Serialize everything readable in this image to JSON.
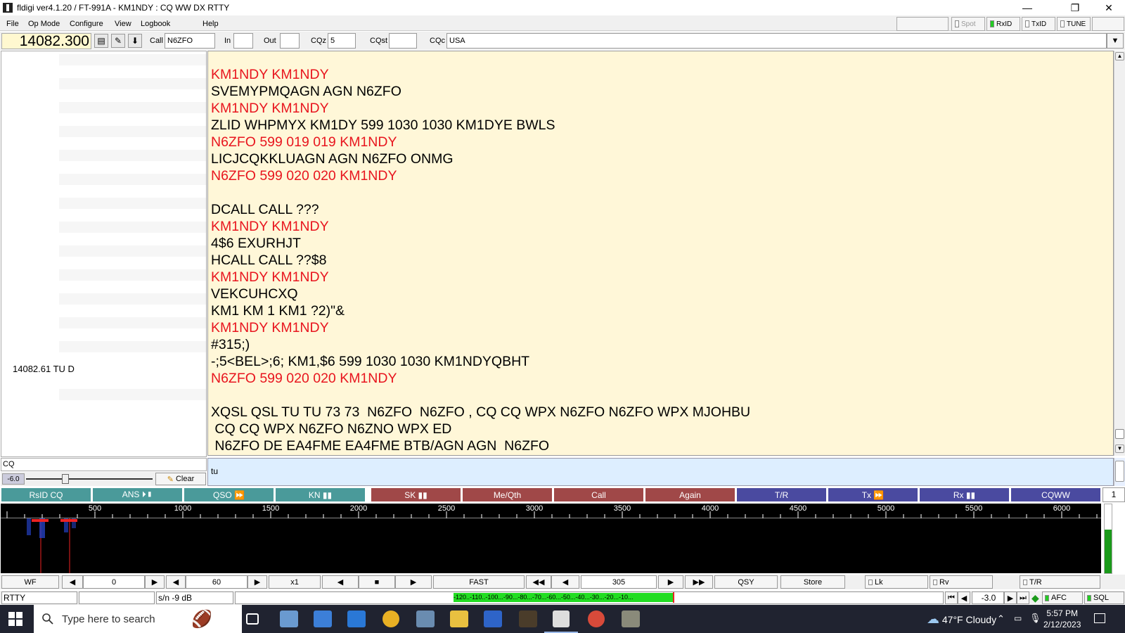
{
  "window": {
    "title": "fldigi ver4.1.20 / FT-991A - KM1NDY :  CQ WW DX RTTY"
  },
  "menu": {
    "items": [
      "File",
      "Op Mode",
      "Configure",
      "View",
      "Logbook",
      "Help"
    ]
  },
  "topbuttons": {
    "spot": "Spot",
    "rxid": "RxID",
    "txid": "TxID",
    "tune": "TUNE"
  },
  "freq": {
    "value": "14082.300"
  },
  "fields": {
    "call_label": "Call",
    "call_value": "N6ZFO",
    "in_label": "In",
    "in_value": "",
    "out_label": "Out",
    "out_value": "",
    "cqz_label": "CQz",
    "cqz_value": "5",
    "cqst_label": "CQst",
    "cqst_value": "",
    "cqc_label": "CQc",
    "cqc_value": "USA"
  },
  "left_panel": {
    "entry": "14082.61  TU D"
  },
  "rx": {
    "lines": [
      {
        "text": "KM1NDY KM1NDY",
        "color": "red"
      },
      {
        "text": "SVEMYPMQAGN AGN N6ZFO",
        "color": "black"
      },
      {
        "text": "KM1NDY KM1NDY",
        "color": "red"
      },
      {
        "text": "ZLID WHPMYX KM1DY 599 1030 1030 KM1DYE BWLS",
        "color": "black"
      },
      {
        "text": "N6ZFO 599 019 019 KM1NDY",
        "color": "red"
      },
      {
        "text": "LICJCQKKLUAGN AGN N6ZFO ONMG",
        "color": "black"
      },
      {
        "text": "N6ZFO 599 020 020 KM1NDY",
        "color": "red"
      },
      {
        "text": "",
        "color": "black"
      },
      {
        "text": "DCALL CALL ???",
        "color": "black"
      },
      {
        "text": "KM1NDY KM1NDY",
        "color": "red"
      },
      {
        "text": "4$6 EXURHJT",
        "color": "black"
      },
      {
        "text": "HCALL CALL ??$8",
        "color": "black"
      },
      {
        "text": "KM1NDY KM1NDY",
        "color": "red"
      },
      {
        "text": "VEKCUHCXQ",
        "color": "black"
      },
      {
        "text": "KM1 KM 1 KM1 ?2)\"&",
        "color": "black"
      },
      {
        "text": "KM1NDY KM1NDY",
        "color": "red"
      },
      {
        "text": "#315;)",
        "color": "black"
      },
      {
        "text": "-;5<BEL>;6; KM1,$6 599 1030 1030 KM1NDYQBHT",
        "color": "black"
      },
      {
        "text": "N6ZFO 599 020 020 KM1NDY",
        "color": "red"
      },
      {
        "text": "",
        "color": "black"
      },
      {
        "text": "XQSL QSL TU TU 73 73  N6ZFO  N6ZFO , CQ CQ WPX N6ZFO N6ZFO WPX MJOHBU",
        "color": "black"
      },
      {
        "text": " CQ CQ WPX N6ZFO N6ZNO WPX ED",
        "color": "black"
      },
      {
        "text": " N6ZFO DE EA4FME EA4FME BTB/AGN AGN  N6ZFO",
        "color": "black"
      }
    ]
  },
  "tx": {
    "text": "tu"
  },
  "search": {
    "value": "CQ"
  },
  "slider": {
    "value": "-6.0",
    "clear": "Clear",
    "level": 0.3
  },
  "macros": [
    {
      "label": "RsID CQ",
      "color": "teal"
    },
    {
      "label": "ANS ⏵▮",
      "color": "teal"
    },
    {
      "label": "QSO ⏩",
      "color": "teal"
    },
    {
      "label": "KN ▮▮",
      "color": "teal"
    },
    {
      "label": "SK ▮▮",
      "color": "maroon"
    },
    {
      "label": "Me/Qth",
      "color": "maroon"
    },
    {
      "label": "Call",
      "color": "maroon"
    },
    {
      "label": "Again",
      "color": "maroon"
    },
    {
      "label": "T/R",
      "color": "navy"
    },
    {
      "label": "Tx ⏩",
      "color": "navy"
    },
    {
      "label": "Rx ▮▮",
      "color": "navy"
    },
    {
      "label": "CQWW",
      "color": "navy"
    }
  ],
  "macro_page": "1",
  "waterfall": {
    "ticks": [
      "500",
      "1000",
      "1500",
      "2000",
      "2500",
      "3000",
      "3500",
      "4000",
      "4500",
      "5000",
      "5500",
      "6000"
    ]
  },
  "controls": {
    "wf": "WF",
    "lower": "0",
    "range": "60",
    "zoom": "x1",
    "speed": "FAST",
    "freq_offset": "305",
    "qsy": "QSY",
    "store": "Store",
    "lk": "Lk",
    "rv": "Rv",
    "tr": "T/R"
  },
  "status": {
    "mode": "RTTY",
    "blank": "",
    "sn": "s/n -9  dB",
    "meter": "-120..-110..-100...-90...-80...-70...-60...-50...-40...-30...-20...-10...",
    "squelch": "-3.0",
    "afc": "AFC",
    "sql": "SQL"
  },
  "taskbar": {
    "search_placeholder": "Type here to search",
    "weather": "47°F  Cloudy",
    "time": "5:57 PM",
    "date": "2/12/2023"
  }
}
